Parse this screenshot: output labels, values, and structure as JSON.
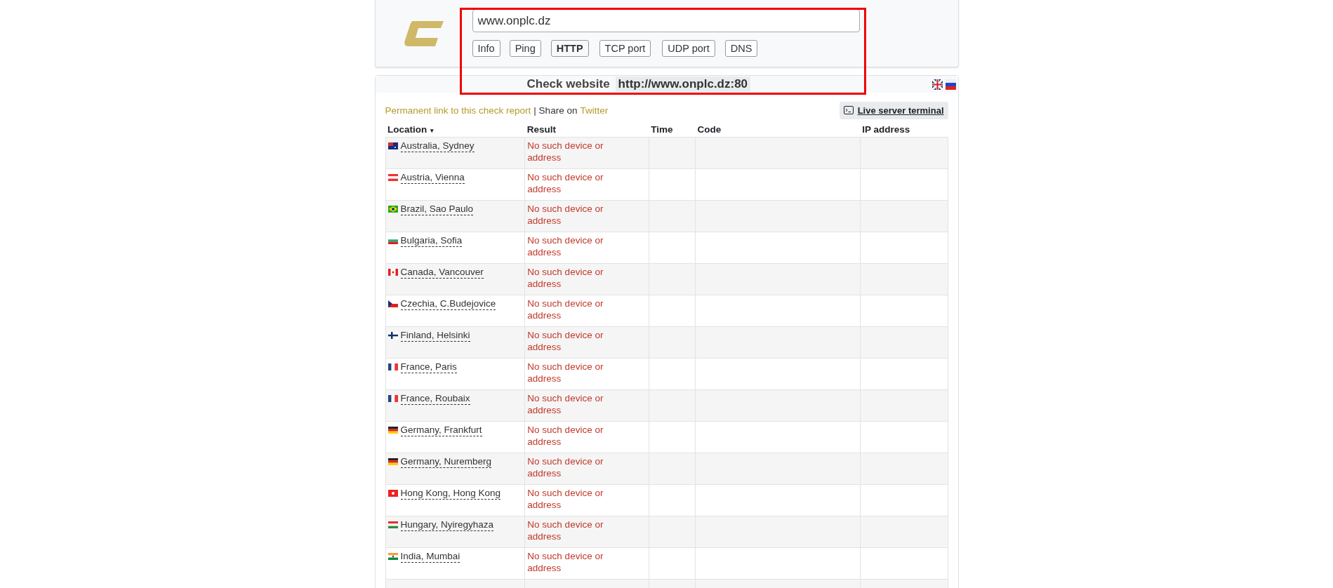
{
  "search": {
    "value": "www.onplc.dz"
  },
  "tabs": [
    {
      "label": "Info",
      "selected": false
    },
    {
      "label": "Ping",
      "selected": false
    },
    {
      "label": "HTTP",
      "selected": true
    },
    {
      "label": "TCP port",
      "selected": false
    },
    {
      "label": "UDP port",
      "selected": false
    },
    {
      "label": "DNS",
      "selected": false
    }
  ],
  "check": {
    "title": "Check website",
    "target": "http://www.onplc.dz:80"
  },
  "links": {
    "permanent": "Permanent link to this check report",
    "separator": "| Share on",
    "twitter": "Twitter",
    "terminal": "Live server terminal"
  },
  "table": {
    "columns": [
      {
        "label": "Location",
        "sort": "▾"
      },
      {
        "label": "Result"
      },
      {
        "label": "Time"
      },
      {
        "label": "Code"
      },
      {
        "label": "IP address"
      }
    ],
    "rows": [
      {
        "location": "Australia, Sydney",
        "result": "No such device or address"
      },
      {
        "location": "Austria, Vienna",
        "result": "No such device or address"
      },
      {
        "location": "Brazil, Sao Paulo",
        "result": "No such device or address"
      },
      {
        "location": "Bulgaria, Sofia",
        "result": "No such device or address"
      },
      {
        "location": "Canada, Vancouver",
        "result": "No such device or address"
      },
      {
        "location": "Czechia, C.Budejovice",
        "result": "No such device or address"
      },
      {
        "location": "Finland, Helsinki",
        "result": "No such device or address"
      },
      {
        "location": "France, Paris",
        "result": "No such device or address"
      },
      {
        "location": "France, Roubaix",
        "result": "No such device or address"
      },
      {
        "location": "Germany, Frankfurt",
        "result": "No such device or address"
      },
      {
        "location": "Germany, Nuremberg",
        "result": "No such device or address"
      },
      {
        "location": "Hong Kong, Hong Kong",
        "result": "No such device or address"
      },
      {
        "location": "Hungary, Nyiregyhaza",
        "result": "No such device or address"
      },
      {
        "location": "India, Mumbai",
        "result": "No such device or address"
      }
    ]
  }
}
